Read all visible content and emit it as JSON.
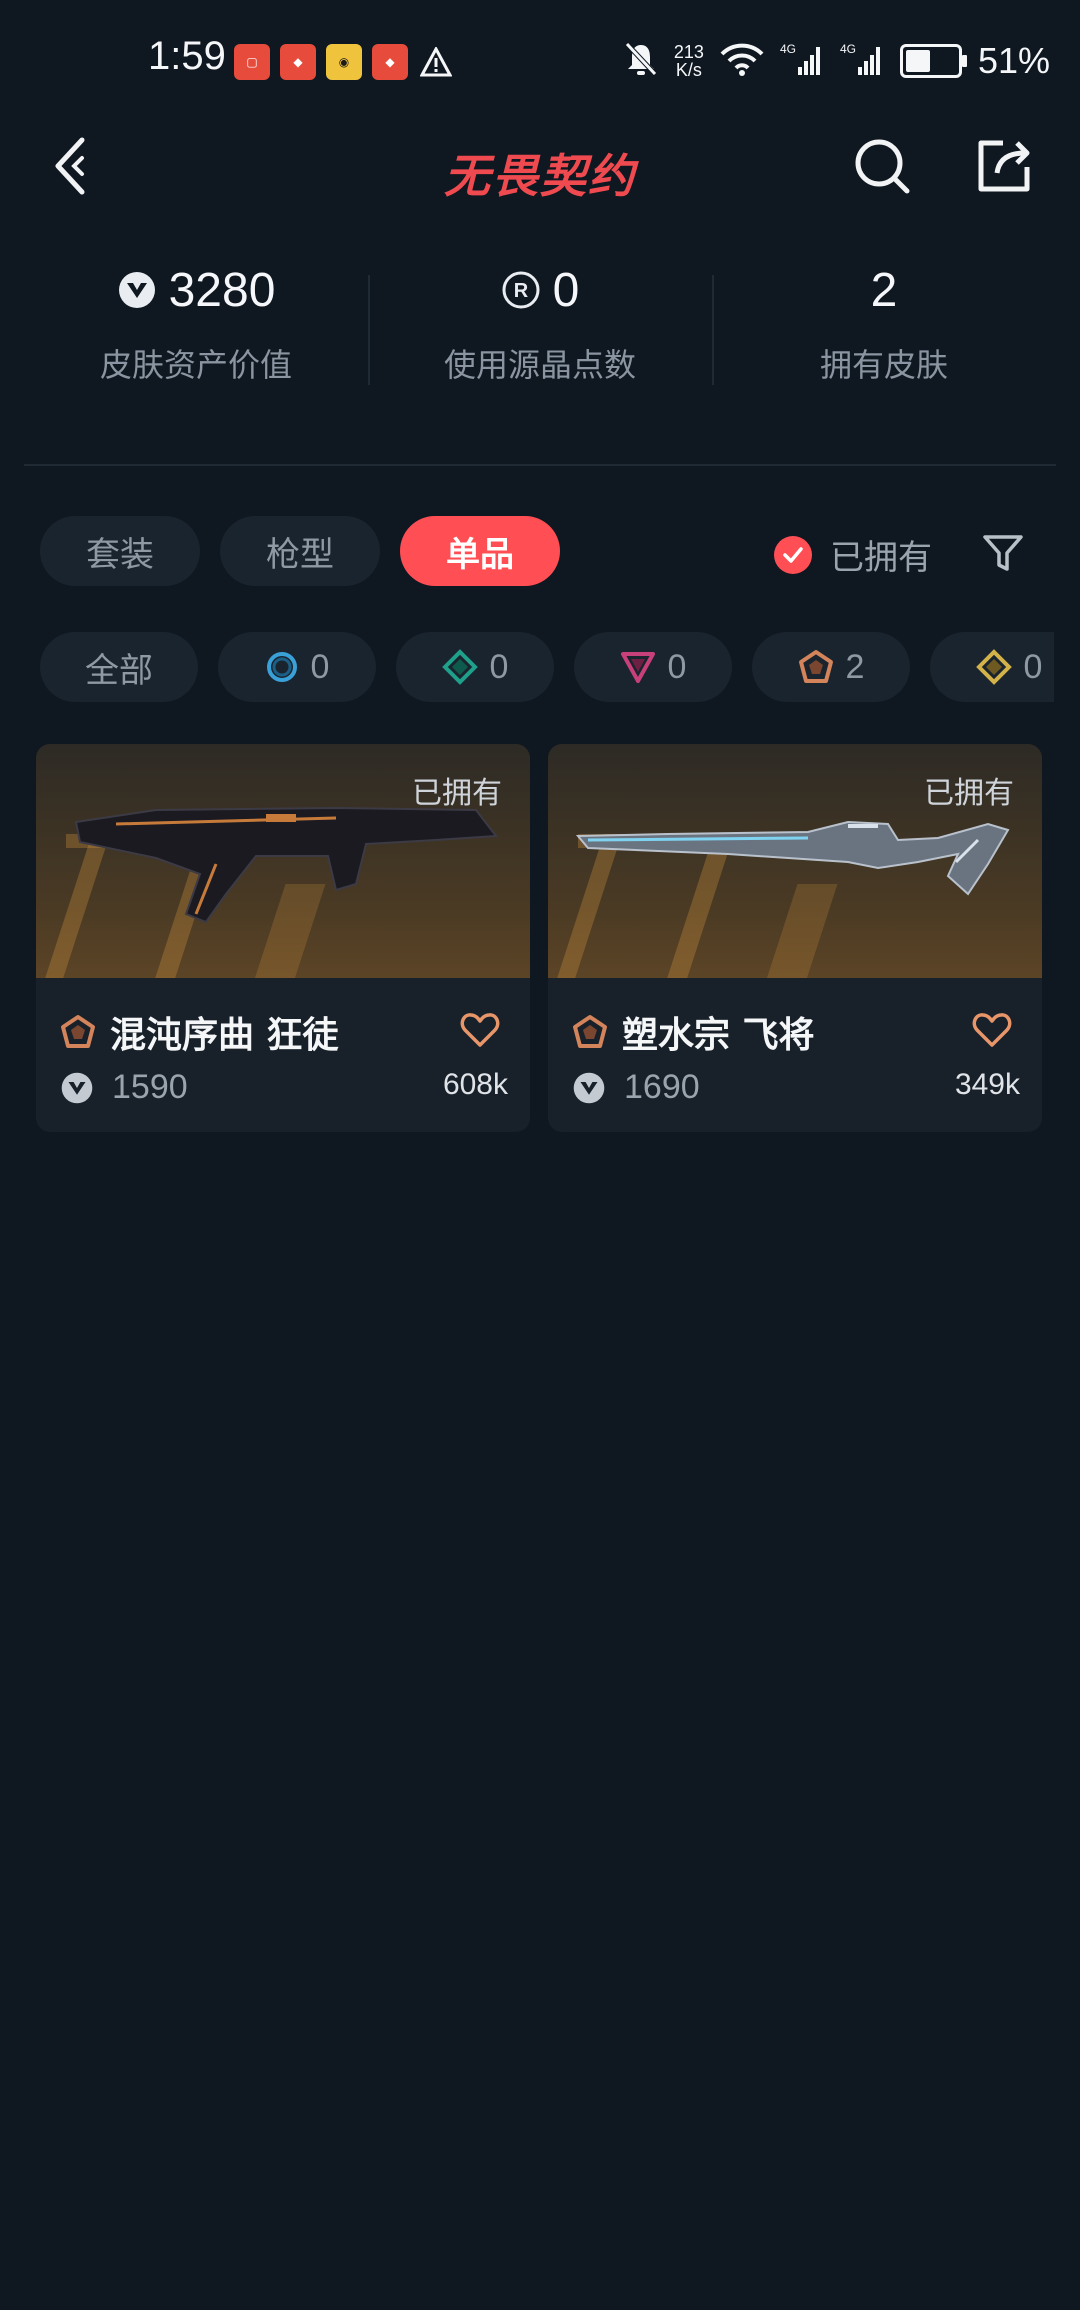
{
  "status_bar": {
    "time": "1:59",
    "net_speed_value": "213",
    "net_speed_unit": "K/s",
    "network_1": "4G",
    "network_2": "4G",
    "battery": "51%"
  },
  "header": {
    "logo_text": "无畏契约",
    "brand_color": "#ef4a4f"
  },
  "stats": [
    {
      "value": "3280",
      "label": "皮肤资产价值",
      "icon": "vp-icon"
    },
    {
      "value": "0",
      "label": "使用源晶点数",
      "icon": "radianite-icon"
    },
    {
      "value": "2",
      "label": "拥有皮肤",
      "icon": ""
    }
  ],
  "tabs": [
    {
      "label": "套装",
      "active": false
    },
    {
      "label": "枪型",
      "active": false
    },
    {
      "label": "单品",
      "active": true
    }
  ],
  "owned_filter": {
    "label": "已拥有",
    "checked": true
  },
  "tiers": {
    "all_label": "全部",
    "items": [
      {
        "name": "select-tier",
        "color": "#3aa0d8",
        "count": "0"
      },
      {
        "name": "deluxe-tier",
        "color": "#1fa08a",
        "count": "0"
      },
      {
        "name": "premium-tier",
        "color": "#c8407a",
        "count": "0"
      },
      {
        "name": "exclusive-tier",
        "color": "#d3845a",
        "count": "2"
      },
      {
        "name": "ultra-tier",
        "color": "#d3b24a",
        "count": "0"
      }
    ]
  },
  "cards": [
    {
      "owned_tag": "已拥有",
      "name": "混沌序曲 狂徒",
      "price": "1590",
      "likes": "608k",
      "tier_color": "#d3845a"
    },
    {
      "owned_tag": "已拥有",
      "name": "塑水宗 飞将",
      "price": "1690",
      "likes": "349k",
      "tier_color": "#d3845a"
    }
  ],
  "colors": {
    "accent": "#ff4f55",
    "background": "#0f1720",
    "chip_bg": "#1a242e",
    "heart": "#e8956a"
  }
}
